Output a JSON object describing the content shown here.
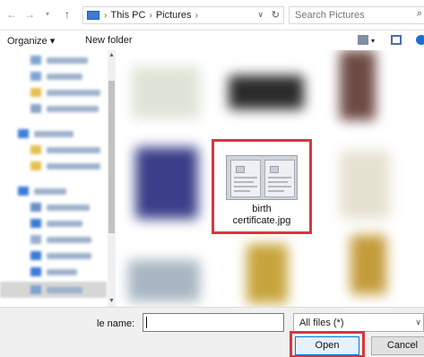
{
  "nav": {
    "back_icon": "back-arrow-icon",
    "forward_icon": "forward-arrow-icon",
    "up_icon": "up-arrow-icon",
    "back_glyph": "←",
    "forward_glyph": "→",
    "up_glyph": "↑"
  },
  "address": {
    "crumbs": [
      "This PC",
      "Pictures"
    ],
    "separator": "›",
    "dropdown_glyph": "∨",
    "refresh_glyph": "↻"
  },
  "search": {
    "placeholder": "Search Pictures",
    "icon_glyph": "⌕"
  },
  "toolbar": {
    "organize_label": "Organize ▾",
    "new_folder_label": "New folder"
  },
  "file": {
    "name_line1": "birth",
    "name_line2": "certificate.jpg"
  },
  "bottom": {
    "file_name_label": "le name:",
    "file_name_value": "",
    "file_type_value": "All files (*)",
    "open_label": "Open",
    "cancel_label": "Cancel",
    "type_chevron": "∨"
  },
  "colors": {
    "highlight": "#d9363e",
    "accent": "#0078d7"
  }
}
